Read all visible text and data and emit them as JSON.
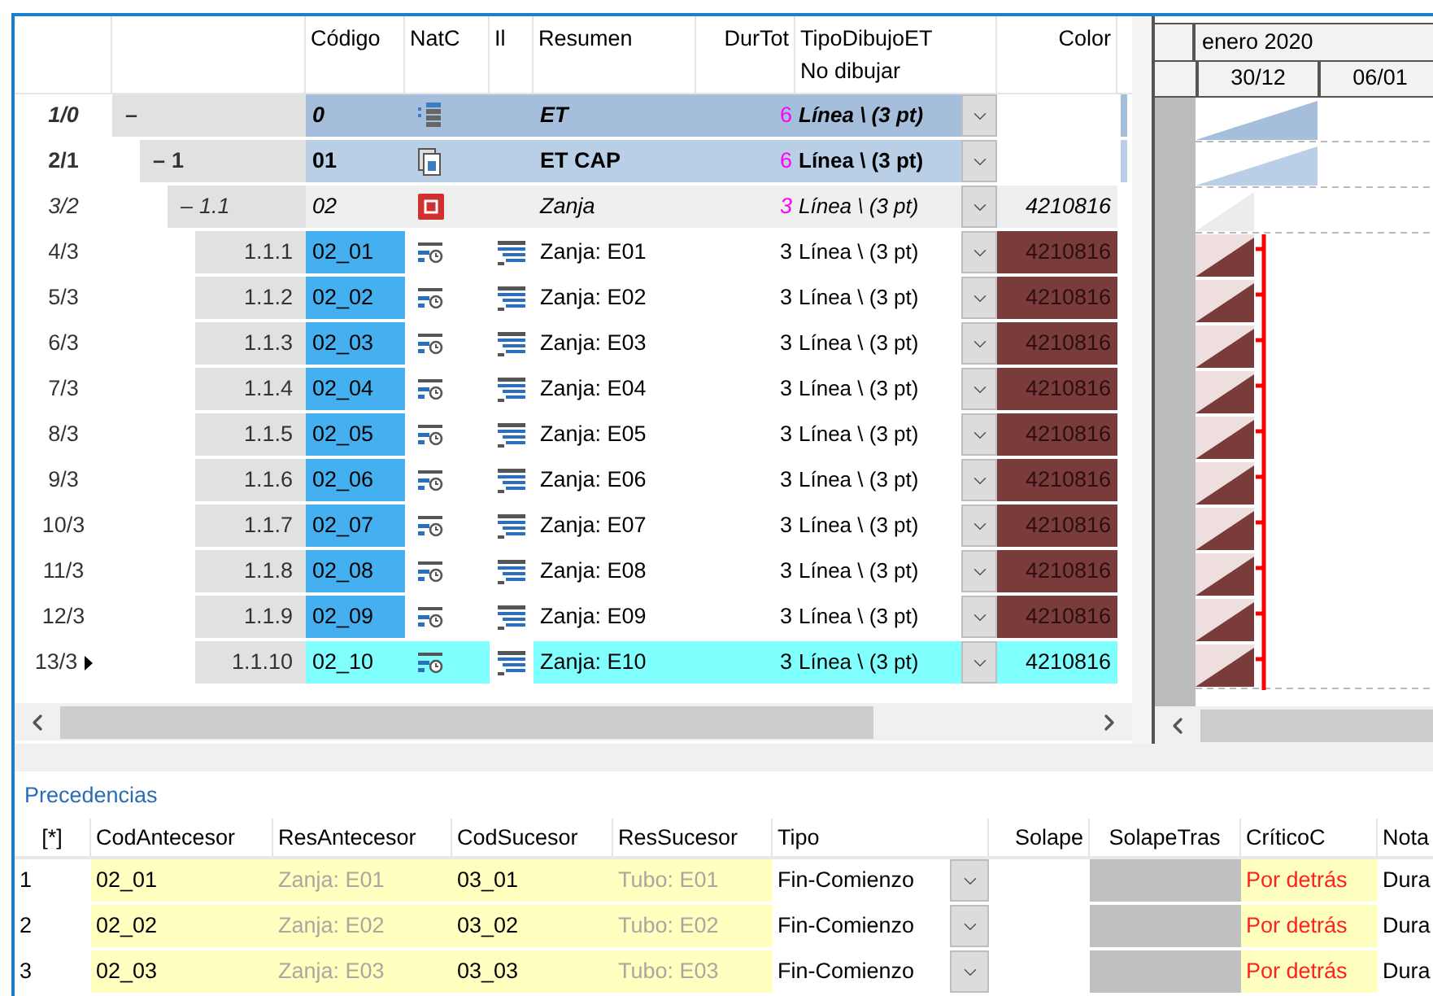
{
  "columns": [
    {
      "label": "Código"
    },
    {
      "label": "NatC"
    },
    {
      "label": "Il"
    },
    {
      "label": "Resumen"
    },
    {
      "label": "DurTot"
    },
    {
      "label": "TipoDibujoET",
      "sublabel": "No dibujar"
    },
    {
      "label": "Color"
    }
  ],
  "rows": [
    {
      "rowno": "1/0",
      "toggle": "–",
      "kind": "root",
      "code": "0",
      "resumen": "ET",
      "durtot": "6",
      "tipo": "Línea \\ (3 pt)",
      "children": [
        {
          "rowno": "2/1",
          "toggle": "–",
          "wbs": "1",
          "kind": "chapter",
          "code": "01",
          "resumen": "ET CAP",
          "durtot": "6",
          "tipo": "Línea \\ (3 pt)",
          "children": [
            {
              "rowno": "3/2",
              "toggle": "–",
              "wbs": "1.1",
              "kind": "group",
              "code": "02",
              "resumen": "Zanja",
              "durtot": "3",
              "tipo": "Línea \\ (3 pt)",
              "color_value": "4210816",
              "children": [
                {
                  "rowno": "4/3",
                  "wbs": "1.1.1",
                  "kind": "task",
                  "current": false,
                  "code": "02_01",
                  "resumen": "Zanja: E01",
                  "durtot": "3",
                  "tipo": "Línea \\ (3 pt)",
                  "color_value": "4210816"
                },
                {
                  "rowno": "5/3",
                  "wbs": "1.1.2",
                  "kind": "task",
                  "current": false,
                  "code": "02_02",
                  "resumen": "Zanja: E02",
                  "durtot": "3",
                  "tipo": "Línea \\ (3 pt)",
                  "color_value": "4210816"
                },
                {
                  "rowno": "6/3",
                  "wbs": "1.1.3",
                  "kind": "task",
                  "current": false,
                  "code": "02_03",
                  "resumen": "Zanja: E03",
                  "durtot": "3",
                  "tipo": "Línea \\ (3 pt)",
                  "color_value": "4210816"
                },
                {
                  "rowno": "7/3",
                  "wbs": "1.1.4",
                  "kind": "task",
                  "current": false,
                  "code": "02_04",
                  "resumen": "Zanja: E04",
                  "durtot": "3",
                  "tipo": "Línea \\ (3 pt)",
                  "color_value": "4210816"
                },
                {
                  "rowno": "8/3",
                  "wbs": "1.1.5",
                  "kind": "task",
                  "current": false,
                  "code": "02_05",
                  "resumen": "Zanja: E05",
                  "durtot": "3",
                  "tipo": "Línea \\ (3 pt)",
                  "color_value": "4210816"
                },
                {
                  "rowno": "9/3",
                  "wbs": "1.1.6",
                  "kind": "task",
                  "current": false,
                  "code": "02_06",
                  "resumen": "Zanja: E06",
                  "durtot": "3",
                  "tipo": "Línea \\ (3 pt)",
                  "color_value": "4210816"
                },
                {
                  "rowno": "10/3",
                  "wbs": "1.1.7",
                  "kind": "task",
                  "current": false,
                  "code": "02_07",
                  "resumen": "Zanja: E07",
                  "durtot": "3",
                  "tipo": "Línea \\ (3 pt)",
                  "color_value": "4210816"
                },
                {
                  "rowno": "11/3",
                  "wbs": "1.1.8",
                  "kind": "task",
                  "current": false,
                  "code": "02_08",
                  "resumen": "Zanja: E08",
                  "durtot": "3",
                  "tipo": "Línea \\ (3 pt)",
                  "color_value": "4210816"
                },
                {
                  "rowno": "12/3",
                  "wbs": "1.1.9",
                  "kind": "task",
                  "current": false,
                  "code": "02_09",
                  "resumen": "Zanja: E09",
                  "durtot": "3",
                  "tipo": "Línea \\ (3 pt)",
                  "color_value": "4210816"
                },
                {
                  "rowno": "13/3",
                  "wbs": "1.1.10",
                  "kind": "task",
                  "current": true,
                  "code": "02_10",
                  "resumen": "Zanja: E10",
                  "durtot": "3",
                  "tipo": "Línea \\ (3 pt)",
                  "color_value": "4210816"
                }
              ]
            }
          ]
        }
      ]
    }
  ],
  "gantt": {
    "month": "enero 2020",
    "weeks": [
      "30/12",
      "06/01"
    ]
  },
  "precedences": {
    "title": "Precedencias",
    "corner": "[*]",
    "columns": [
      "CodAntecesor",
      "ResAntecesor",
      "CodSucesor",
      "ResSucesor",
      "Tipo",
      "Solape",
      "SolapeTras",
      "CríticoC",
      "Nota"
    ],
    "rows": [
      {
        "n": "1",
        "cod_ant": "02_01",
        "res_ant": "Zanja: E01",
        "cod_suc": "03_01",
        "res_suc": "Tubo: E01",
        "tipo": "Fin-Comienzo",
        "critico": "Por detrás",
        "nota": "Dura"
      },
      {
        "n": "2",
        "cod_ant": "02_02",
        "res_ant": "Zanja: E02",
        "cod_suc": "03_02",
        "res_suc": "Tubo: E02",
        "tipo": "Fin-Comienzo",
        "critico": "Por detrás",
        "nota": "Dura"
      },
      {
        "n": "3",
        "cod_ant": "02_03",
        "res_ant": "Zanja: E03",
        "cod_suc": "03_03",
        "res_suc": "Tubo: E03",
        "tipo": "Fin-Comienzo",
        "critico": "Por detrás",
        "nota": "Dura"
      }
    ]
  }
}
